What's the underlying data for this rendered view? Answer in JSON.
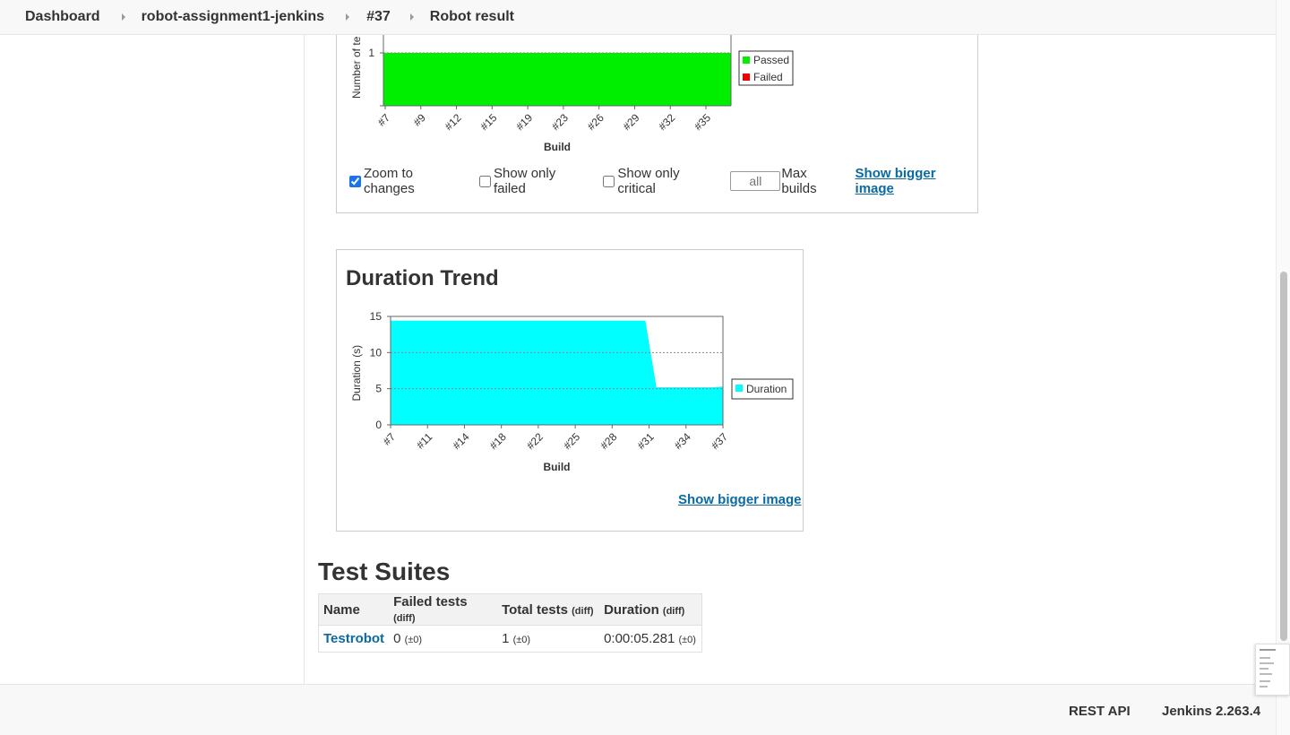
{
  "breadcrumb": {
    "items": [
      "Dashboard",
      "robot-assignment1-jenkins",
      "#37",
      "Robot result"
    ]
  },
  "result_trend": {
    "legend": [
      "Passed",
      "Failed"
    ],
    "controls": {
      "zoom_label": "Zoom to changes",
      "zoom_checked": true,
      "only_failed_label": "Show only failed",
      "only_failed_checked": false,
      "only_critical_label": "Show only critical",
      "only_critical_checked": false,
      "max_builds_placeholder": "all",
      "max_builds_label": "Max builds",
      "bigger_image_link": "Show bigger image"
    }
  },
  "duration_trend": {
    "title": "Duration Trend",
    "bigger_image_link": "Show bigger image"
  },
  "chart_data": [
    {
      "type": "area",
      "title": "",
      "xlabel": "Build",
      "ylabel": "Number of te",
      "x_ticks": [
        "#7",
        "#9",
        "#12",
        "#15",
        "#19",
        "#23",
        "#26",
        "#29",
        "#32",
        "#35"
      ],
      "y_ticks": [
        1
      ],
      "series": [
        {
          "name": "Passed",
          "color": "#00ee00",
          "x": [
            "#7",
            "#37"
          ],
          "values": [
            1,
            1
          ]
        },
        {
          "name": "Failed",
          "color": "#ee0000",
          "x": [
            "#7",
            "#37"
          ],
          "values": [
            0,
            0
          ]
        }
      ],
      "legend_position": "right",
      "grid": true
    },
    {
      "type": "area",
      "title": "",
      "xlabel": "Build",
      "ylabel": "Duration (s)",
      "x_ticks": [
        "#7",
        "#11",
        "#14",
        "#18",
        "#22",
        "#25",
        "#28",
        "#31",
        "#34",
        "#37"
      ],
      "y_ticks": [
        0,
        5,
        10,
        15
      ],
      "ylim": [
        0,
        15
      ],
      "series": [
        {
          "name": "Duration",
          "color": "#00ffff",
          "x": [
            7,
            8,
            9,
            10,
            11,
            12,
            13,
            14,
            15,
            16,
            17,
            18,
            19,
            20,
            21,
            22,
            23,
            24,
            25,
            26,
            27,
            28,
            29,
            30,
            31,
            32,
            33,
            34,
            35,
            36,
            37
          ],
          "values": [
            14.4,
            14.4,
            14.4,
            14.4,
            14.4,
            14.4,
            14.4,
            14.4,
            14.4,
            14.4,
            14.4,
            14.4,
            14.4,
            14.4,
            14.4,
            14.4,
            14.4,
            14.4,
            14.4,
            14.4,
            14.4,
            14.4,
            14.4,
            14.4,
            5.2,
            5.2,
            5.2,
            5.2,
            5.2,
            5.2,
            5.3
          ]
        }
      ],
      "legend_position": "right",
      "grid": true
    }
  ],
  "test_suites": {
    "title": "Test Suites",
    "headers": [
      {
        "label": "Name",
        "diff": ""
      },
      {
        "label": "Failed tests",
        "diff": "(diff)"
      },
      {
        "label": "Total tests",
        "diff": "(diff)"
      },
      {
        "label": "Duration",
        "diff": "(diff)"
      }
    ],
    "rows": [
      {
        "name": "Testrobot",
        "failed": "0",
        "failed_diff": "(±0)",
        "total": "1",
        "total_diff": "(±0)",
        "duration": "0:00:05.281",
        "duration_diff": "(±0)"
      }
    ]
  },
  "footer": {
    "rest_api": "REST API",
    "version": "Jenkins 2.263.4"
  }
}
